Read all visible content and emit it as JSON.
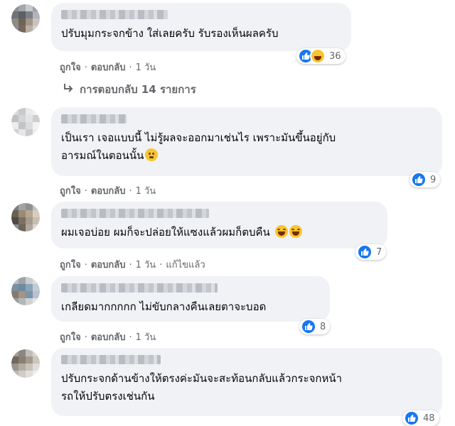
{
  "comments": [
    {
      "text": "ปรับมุมกระจกข้าง ใส่เลยครับ รับรองเห็นผลครับ",
      "reactions": [
        "like",
        "haha"
      ],
      "reaction_count": "36",
      "like_label": "ถูกใจ",
      "reply_label": "ตอบกลับ",
      "time": "1 วัน",
      "edited": ""
    },
    {
      "text": "เป็นเรา เจอแบบนี้ ไม่รู้ผลจะออกมาเช่นไร เพราะมันขึ้นอยู่กับ\nอารมณ์ในตอนนั้น",
      "emoji": "worried-face",
      "reactions": [
        "like"
      ],
      "reaction_count": "9",
      "like_label": "ถูกใจ",
      "reply_label": "ตอบกลับ",
      "time": "1 วัน",
      "edited": ""
    },
    {
      "text": "ผมเจอบ่อย ผมก็จะปล่อยให้แซงแล้วผมก็ตบคืน",
      "emoji": "laughing-face x2",
      "reactions": [
        "like"
      ],
      "reaction_count": "7",
      "like_label": "ถูกใจ",
      "reply_label": "ตอบกลับ",
      "time": "1 วัน",
      "edited": "แก้ไขแล้ว"
    },
    {
      "text": "เกลียดมากกกกก ไม่ขับกลางคืนเลยตาจะบอด",
      "reactions": [
        "like"
      ],
      "reaction_count": "8",
      "like_label": "ถูกใจ",
      "reply_label": "ตอบกลับ",
      "time": "1 วัน",
      "edited": ""
    },
    {
      "text": "ปรับกระจกด้านข้างให้ตรงค่ะมันจะสะท้อนกลับแล้วกระจกหน้า\nรถให้ปรับตรงเช่นกัน",
      "reactions": [
        "like"
      ],
      "reaction_count": "48"
    }
  ],
  "view_replies": "การตอบกลับ 14 รายการ",
  "view_replies_icon": "reply-arrow-icon",
  "colors": {
    "bubble": "#f0f2f5",
    "meta_text": "#65676b",
    "like_blue": "#1877f2",
    "haha_yellow": "#f7c531"
  }
}
